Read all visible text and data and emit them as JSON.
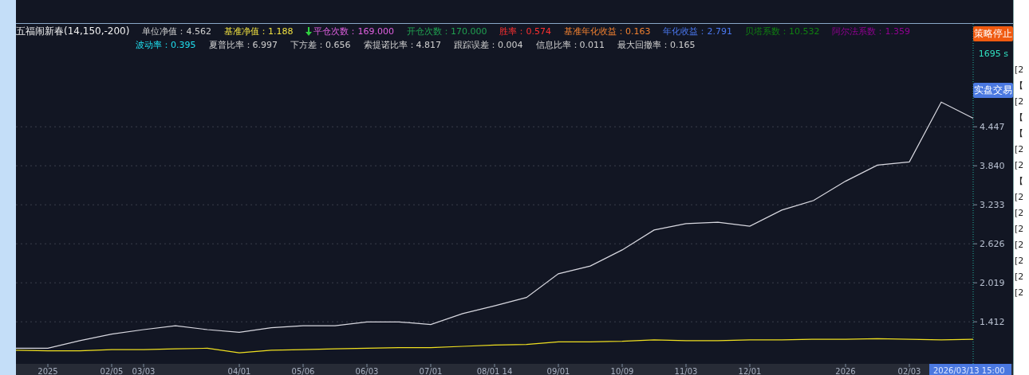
{
  "strategy": {
    "title": "五福闹新春(14,150,-200)",
    "stats_row_1": [
      {
        "text": "单位净值：4.562",
        "color": "#d0d0d0",
        "kind": "plain"
      },
      {
        "text": "基准净值：1.188",
        "color": "#f0e040",
        "kind": "plain"
      },
      {
        "text": "平仓次数：169.000",
        "color": "#e060e0",
        "kind": "arrow"
      },
      {
        "text": "开仓次数：170.000",
        "color": "#20a050",
        "kind": "plain"
      },
      {
        "text": "胜率：0.574",
        "color": "#ff3030",
        "kind": "plain"
      },
      {
        "text": "基准年化收益：0.163",
        "color": "#f08030",
        "kind": "plain"
      },
      {
        "text": "年化收益：2.791",
        "color": "#4a78f0",
        "kind": "plain"
      },
      {
        "text": "贝塔系数：10.532",
        "color": "#108010",
        "kind": "plain"
      },
      {
        "text": "阿尔法系数：1.359",
        "color": "#900090",
        "kind": "plain"
      }
    ],
    "stats_row_2": [
      {
        "text": "波动率：0.395",
        "color": "#20e0f0",
        "kind": "plain"
      },
      {
        "text": "夏普比率：6.997",
        "color": "#d0d0d0",
        "kind": "plain"
      },
      {
        "text": "下方差：0.656",
        "color": "#d0d0d0",
        "kind": "plain"
      },
      {
        "text": "索提诺比率：4.817",
        "color": "#d0d0d0",
        "kind": "plain"
      },
      {
        "text": "跟踪误差：0.004",
        "color": "#d0d0d0",
        "kind": "plain"
      },
      {
        "text": "信息比率：0.011",
        "color": "#d0d0d0",
        "kind": "plain"
      },
      {
        "text": "最大回撤率：0.165",
        "color": "#d0d0d0",
        "kind": "plain"
      }
    ]
  },
  "status": {
    "stopped_label": "策略停止",
    "elapsed": "1695 s",
    "mode_label": "实盘交易"
  },
  "chart": {
    "cursor_label": "2026/03/13 15:00",
    "chart_data": {
      "type": "line",
      "categories": [
        null,
        "2025",
        null,
        "02/05",
        "03/03",
        null,
        null,
        "04/01",
        null,
        "05/06",
        null,
        "06/03",
        null,
        "07/01",
        null,
        "08/01 14",
        null,
        "09/01",
        null,
        "10/09",
        null,
        "11/03",
        null,
        "12/01",
        null,
        null,
        "2026",
        null,
        "02/03",
        null,
        null
      ],
      "series": [
        {
          "color": "#d8d8e0",
          "values": [
            1.0,
            1.0,
            1.12,
            1.22,
            1.29,
            1.35,
            1.29,
            1.25,
            1.32,
            1.35,
            1.35,
            1.41,
            1.41,
            1.37,
            1.54,
            1.66,
            1.79,
            2.16,
            2.28,
            2.53,
            2.84,
            2.94,
            2.96,
            2.9,
            3.15,
            3.3,
            3.6,
            3.85,
            3.9,
            4.83,
            4.58
          ]
        },
        {
          "color": "#f0e020",
          "values": [
            0.97,
            0.96,
            0.96,
            0.98,
            0.98,
            0.99,
            1.0,
            0.93,
            0.97,
            0.98,
            0.99,
            1.0,
            1.01,
            1.01,
            1.03,
            1.05,
            1.06,
            1.1,
            1.1,
            1.11,
            1.13,
            1.12,
            1.12,
            1.13,
            1.13,
            1.14,
            1.14,
            1.15,
            1.14,
            1.13,
            1.14
          ]
        }
      ],
      "ylim": [
        0.5966,
        6.432
      ],
      "grid": true,
      "yticks": [
        1.412,
        2.019,
        2.626,
        3.233,
        {
          "value": 3.84,
          "label": "3.840"
        },
        4.447
      ]
    }
  },
  "side_panel": {
    "items": [
      "[2",
      "【",
      "[2",
      "【",
      "【",
      "[2",
      "[2",
      "【",
      "[2",
      "[2",
      "[2",
      "[2",
      "[2",
      "[2",
      "[2"
    ]
  }
}
